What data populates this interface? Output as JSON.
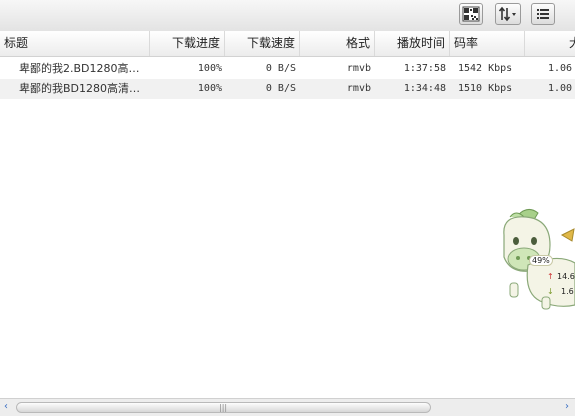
{
  "toolbar": {
    "buttons": [
      {
        "icon": "qr-code-icon"
      },
      {
        "icon": "sort-icon"
      },
      {
        "icon": "list-view-icon"
      }
    ]
  },
  "columns": [
    "标题",
    "下载进度",
    "下载速度",
    "格式",
    "播放时间",
    "码率",
    "大"
  ],
  "rows": [
    {
      "title": "卑鄙的我2.BD1280高…",
      "progress": "100%",
      "speed": "0 B/S",
      "format": "rmvb",
      "duration": "1:37:58",
      "bitrate": "1542 Kbps",
      "size": "1.06"
    },
    {
      "title": "卑鄙的我BD1280高清…",
      "progress": "100%",
      "speed": "0 B/S",
      "format": "rmvb",
      "duration": "1:34:48",
      "bitrate": "1510 Kbps",
      "size": "1.00"
    }
  ],
  "widget": {
    "percent": "49%",
    "upload": "14.6",
    "download": "1.6",
    "upload_arrow": "↑",
    "download_arrow": "↓"
  },
  "scrollbar": {
    "grip": "|||",
    "left_arrow": "‹",
    "right_arrow": "›"
  }
}
